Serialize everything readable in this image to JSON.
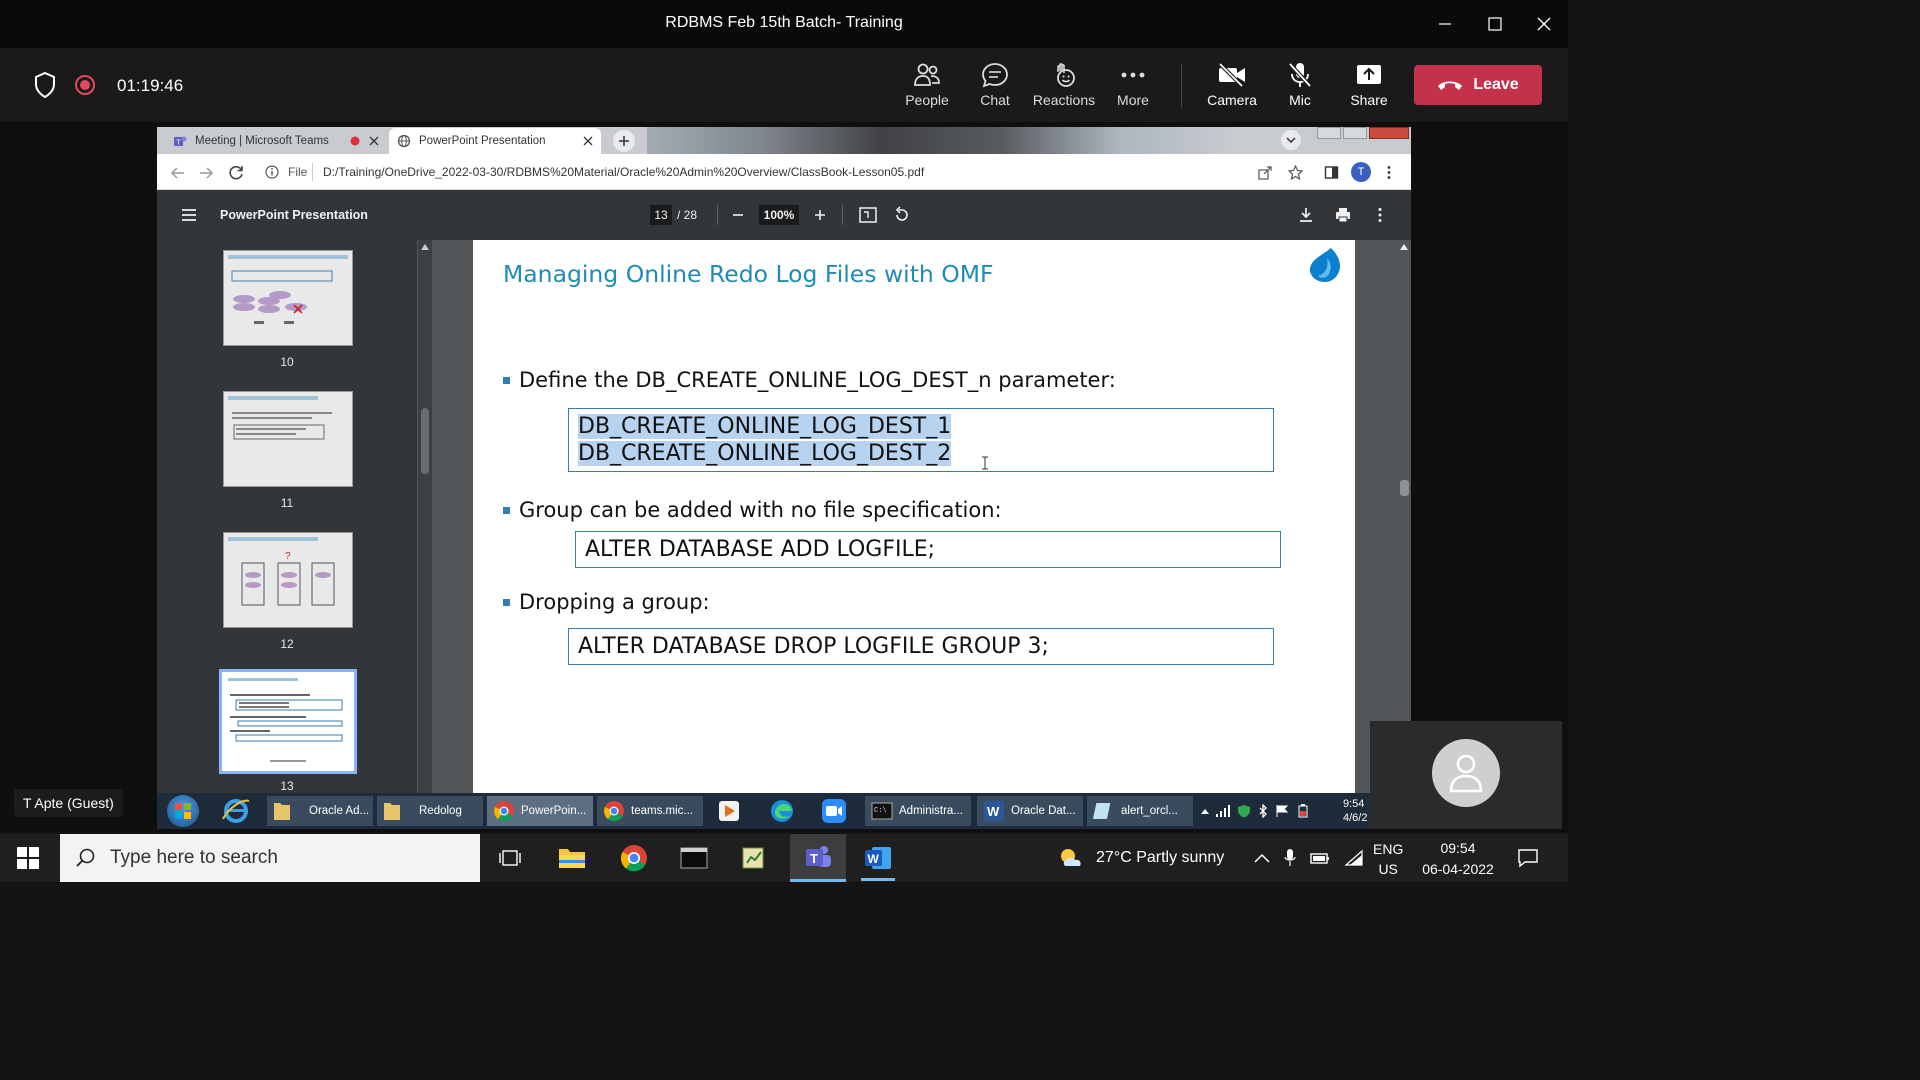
{
  "window": {
    "title": "RDBMS Feb 15th Batch- Training"
  },
  "meeting": {
    "timer": "01:19:46",
    "buttons": [
      {
        "label": "People",
        "icon": "people-icon"
      },
      {
        "label": "Chat",
        "icon": "chat-icon"
      },
      {
        "label": "Reactions",
        "icon": "reactions-icon"
      },
      {
        "label": "More",
        "icon": "more-icon"
      },
      {
        "label": "Camera",
        "icon": "camera-off-icon"
      },
      {
        "label": "Mic",
        "icon": "mic-off-icon"
      },
      {
        "label": "Share",
        "icon": "share-icon"
      }
    ],
    "leave_label": "Leave",
    "guest_name": "T Apte (Guest)"
  },
  "browser": {
    "tabs": [
      {
        "label": "Meeting | Microsoft Teams"
      },
      {
        "label": "PowerPoint Presentation"
      }
    ],
    "url_prefix": "File",
    "url": "D:/Training/OneDrive_2022-03-30/RDBMS%20Material/Oracle%20Admin%20Overview/ClassBook-Lesson05.pdf",
    "profile_initial": "T"
  },
  "pdf": {
    "doc_title": "PowerPoint Presentation",
    "current_page": "13",
    "total_pages": "/ 28",
    "zoom": "100%",
    "thumbnails": [
      {
        "label": "10"
      },
      {
        "label": "11"
      },
      {
        "label": "12"
      },
      {
        "label": "13"
      }
    ]
  },
  "slide": {
    "title": "Managing Online Redo Log Files with OMF",
    "bullet1": "Define the DB_CREATE_ONLINE_LOG_DEST_n parameter:",
    "code1_line1": "DB_CREATE_ONLINE_LOG_DEST_1",
    "code1_line2": "DB_CREATE_ONLINE_LOG_DEST_2",
    "bullet2": "Group can be added with no file specification:",
    "code2": "ALTER DATABASE ADD LOGFILE;",
    "bullet3": "Dropping a group:",
    "code3": "ALTER DATABASE DROP LOGFILE GROUP 3;"
  },
  "remote_taskbar": {
    "items": [
      {
        "label": "Oracle Ad..."
      },
      {
        "label": "Redolog"
      },
      {
        "label": "PowerPoin..."
      },
      {
        "label": "teams.mic..."
      },
      {
        "label": "Administra..."
      },
      {
        "label": "Oracle Dat..."
      },
      {
        "label": "alert_orcl..."
      }
    ],
    "clock_time": "9:54",
    "clock_date": "4/6/2"
  },
  "taskbar": {
    "search_placeholder": "Type here to search",
    "weather": "27°C  Partly sunny",
    "lang_top": "ENG",
    "lang_bottom": "US",
    "time": "09:54",
    "date": "06-04-2022"
  }
}
